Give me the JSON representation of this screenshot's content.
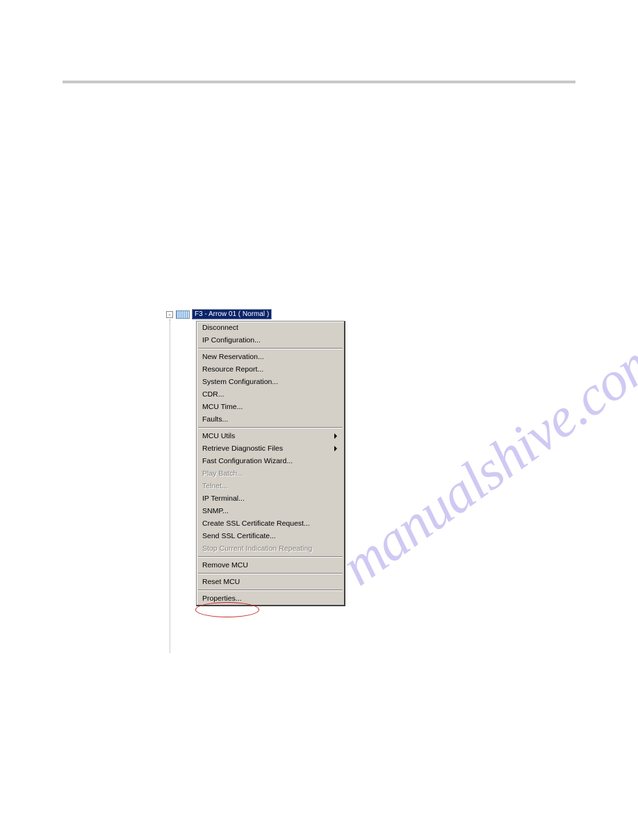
{
  "watermark_text": "manualshive.com",
  "tree": {
    "expander": "-",
    "label": "F3 - Arrow 01   ( Normal )"
  },
  "menu": {
    "group1": [
      {
        "label": "Disconnect",
        "disabled": false
      },
      {
        "label": "IP Configuration...",
        "disabled": false
      }
    ],
    "group2": [
      {
        "label": "New Reservation...",
        "disabled": false
      },
      {
        "label": "Resource Report...",
        "disabled": false
      },
      {
        "label": "System Configuration...",
        "disabled": false
      },
      {
        "label": "CDR...",
        "disabled": false
      },
      {
        "label": "MCU Time...",
        "disabled": false
      },
      {
        "label": "Faults...",
        "disabled": false
      }
    ],
    "group3": [
      {
        "label": "MCU Utils",
        "disabled": false,
        "submenu": true
      },
      {
        "label": "Retrieve Diagnostic Files",
        "disabled": false,
        "submenu": true
      },
      {
        "label": "Fast Configuration Wizard...",
        "disabled": false
      },
      {
        "label": "Play Batch...",
        "disabled": true
      },
      {
        "label": "Telnet...",
        "disabled": true
      },
      {
        "label": "IP Terminal...",
        "disabled": false
      },
      {
        "label": "SNMP...",
        "disabled": false
      },
      {
        "label": "Create SSL Certificate Request...",
        "disabled": false
      },
      {
        "label": "Send SSL Certificate...",
        "disabled": false
      },
      {
        "label": "Stop Current Indication Repeating",
        "disabled": true
      }
    ],
    "group4": [
      {
        "label": "Remove MCU",
        "disabled": false
      }
    ],
    "group5": [
      {
        "label": "Reset MCU",
        "disabled": false
      }
    ],
    "group6": [
      {
        "label": "Properties...",
        "disabled": false
      }
    ]
  }
}
